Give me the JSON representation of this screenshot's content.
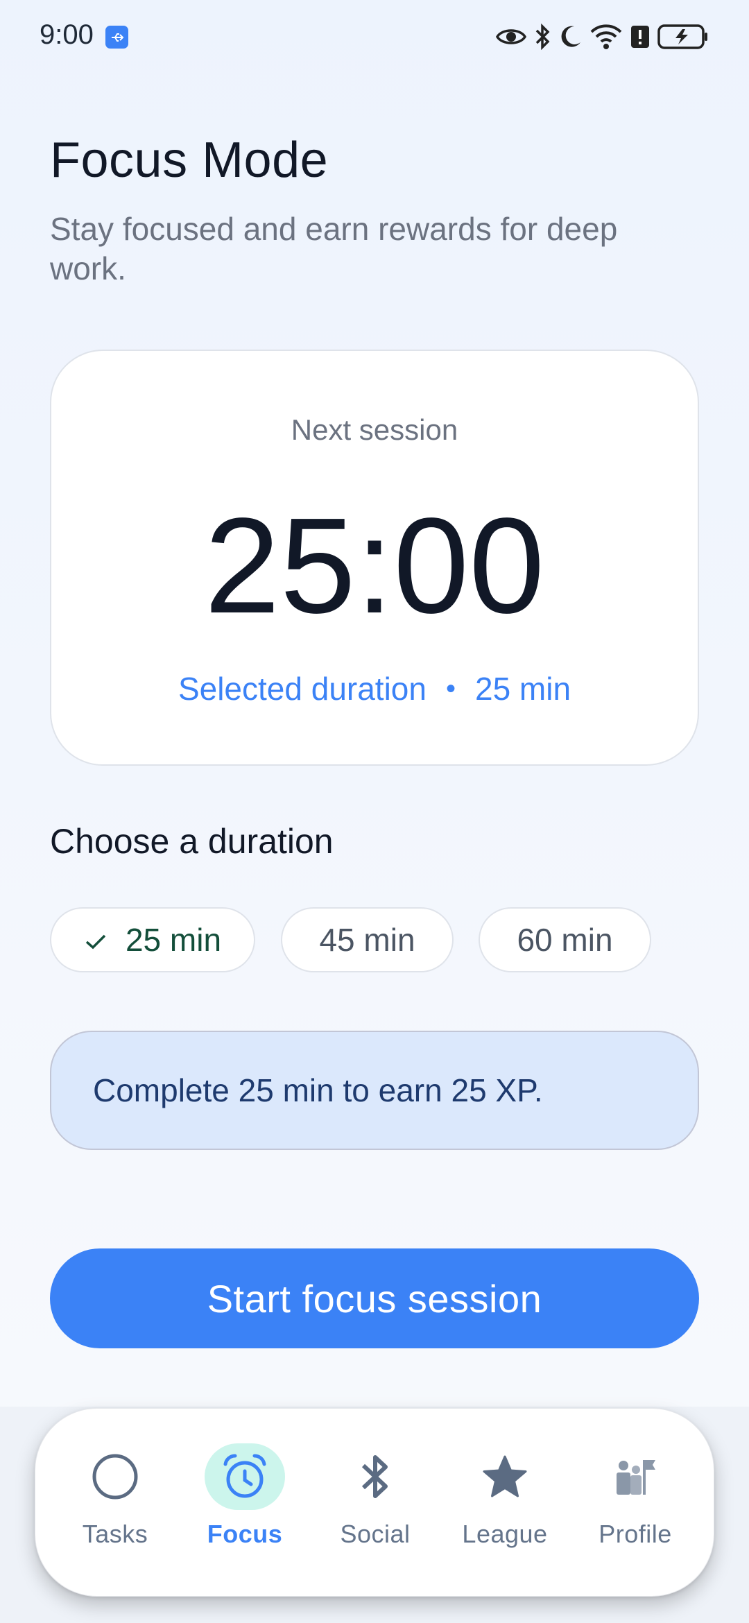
{
  "status_bar": {
    "time": "9:00",
    "icons": [
      "usb-icon",
      "eye-icon",
      "bluetooth-icon",
      "moon-icon",
      "wifi-icon",
      "alert-icon",
      "battery-charging-icon"
    ]
  },
  "header": {
    "title": "Focus Mode",
    "subtitle": "Stay focused and earn rewards for deep work."
  },
  "session_card": {
    "label": "Next session",
    "time": "25:00",
    "duration_label": "Selected duration",
    "separator": "•",
    "duration_value": "25 min"
  },
  "duration_picker": {
    "heading": "Choose a duration",
    "options": [
      {
        "label": "25 min",
        "selected": true
      },
      {
        "label": "45 min",
        "selected": false
      },
      {
        "label": "60 min",
        "selected": false
      }
    ]
  },
  "xp_banner": {
    "text": "Complete 25 min to earn 25 XP."
  },
  "start_button": {
    "label": "Start focus session"
  },
  "bottom_nav": {
    "items": [
      {
        "label": "Tasks",
        "icon": "circle-icon",
        "active": false
      },
      {
        "label": "Focus",
        "icon": "alarm-clock-icon",
        "active": true
      },
      {
        "label": "Social",
        "icon": "bluetooth-icon",
        "active": false
      },
      {
        "label": "League",
        "icon": "star-icon",
        "active": false
      },
      {
        "label": "Profile",
        "icon": "people-flag-icon",
        "active": false
      }
    ]
  },
  "colors": {
    "accent": "#3b82f6",
    "active_pill": "#ccf5ec",
    "banner_bg": "#dbe8fc",
    "text_primary": "#111827",
    "text_muted": "#6b7280"
  }
}
